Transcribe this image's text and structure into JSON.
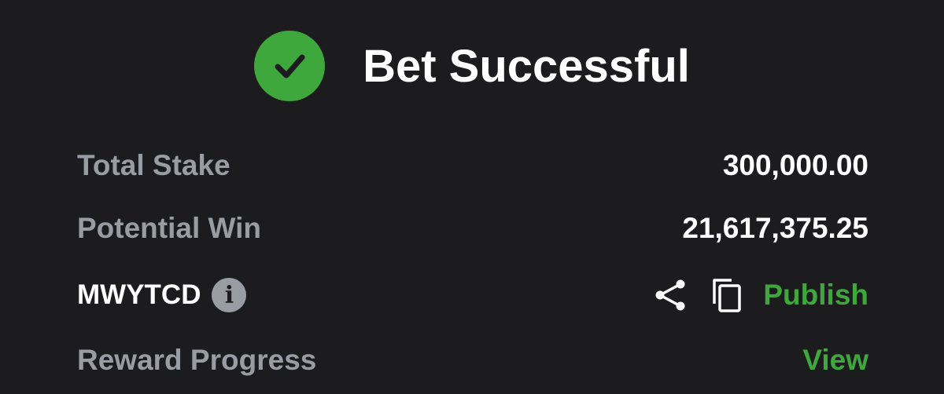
{
  "header": {
    "title": "Bet Successful",
    "status_icon": "check-circle-icon",
    "accent_color": "#3fa83c"
  },
  "rows": {
    "total_stake": {
      "label": "Total Stake",
      "value": "300,000.00"
    },
    "potential_win": {
      "label": "Potential Win",
      "value": "21,617,375.25"
    },
    "booking": {
      "code": "MWYTCD",
      "info_icon": "info-icon",
      "share_icon": "share-icon",
      "copy_icon": "copy-icon",
      "publish_label": "Publish"
    },
    "reward_progress": {
      "label": "Reward Progress",
      "view_label": "View"
    }
  }
}
